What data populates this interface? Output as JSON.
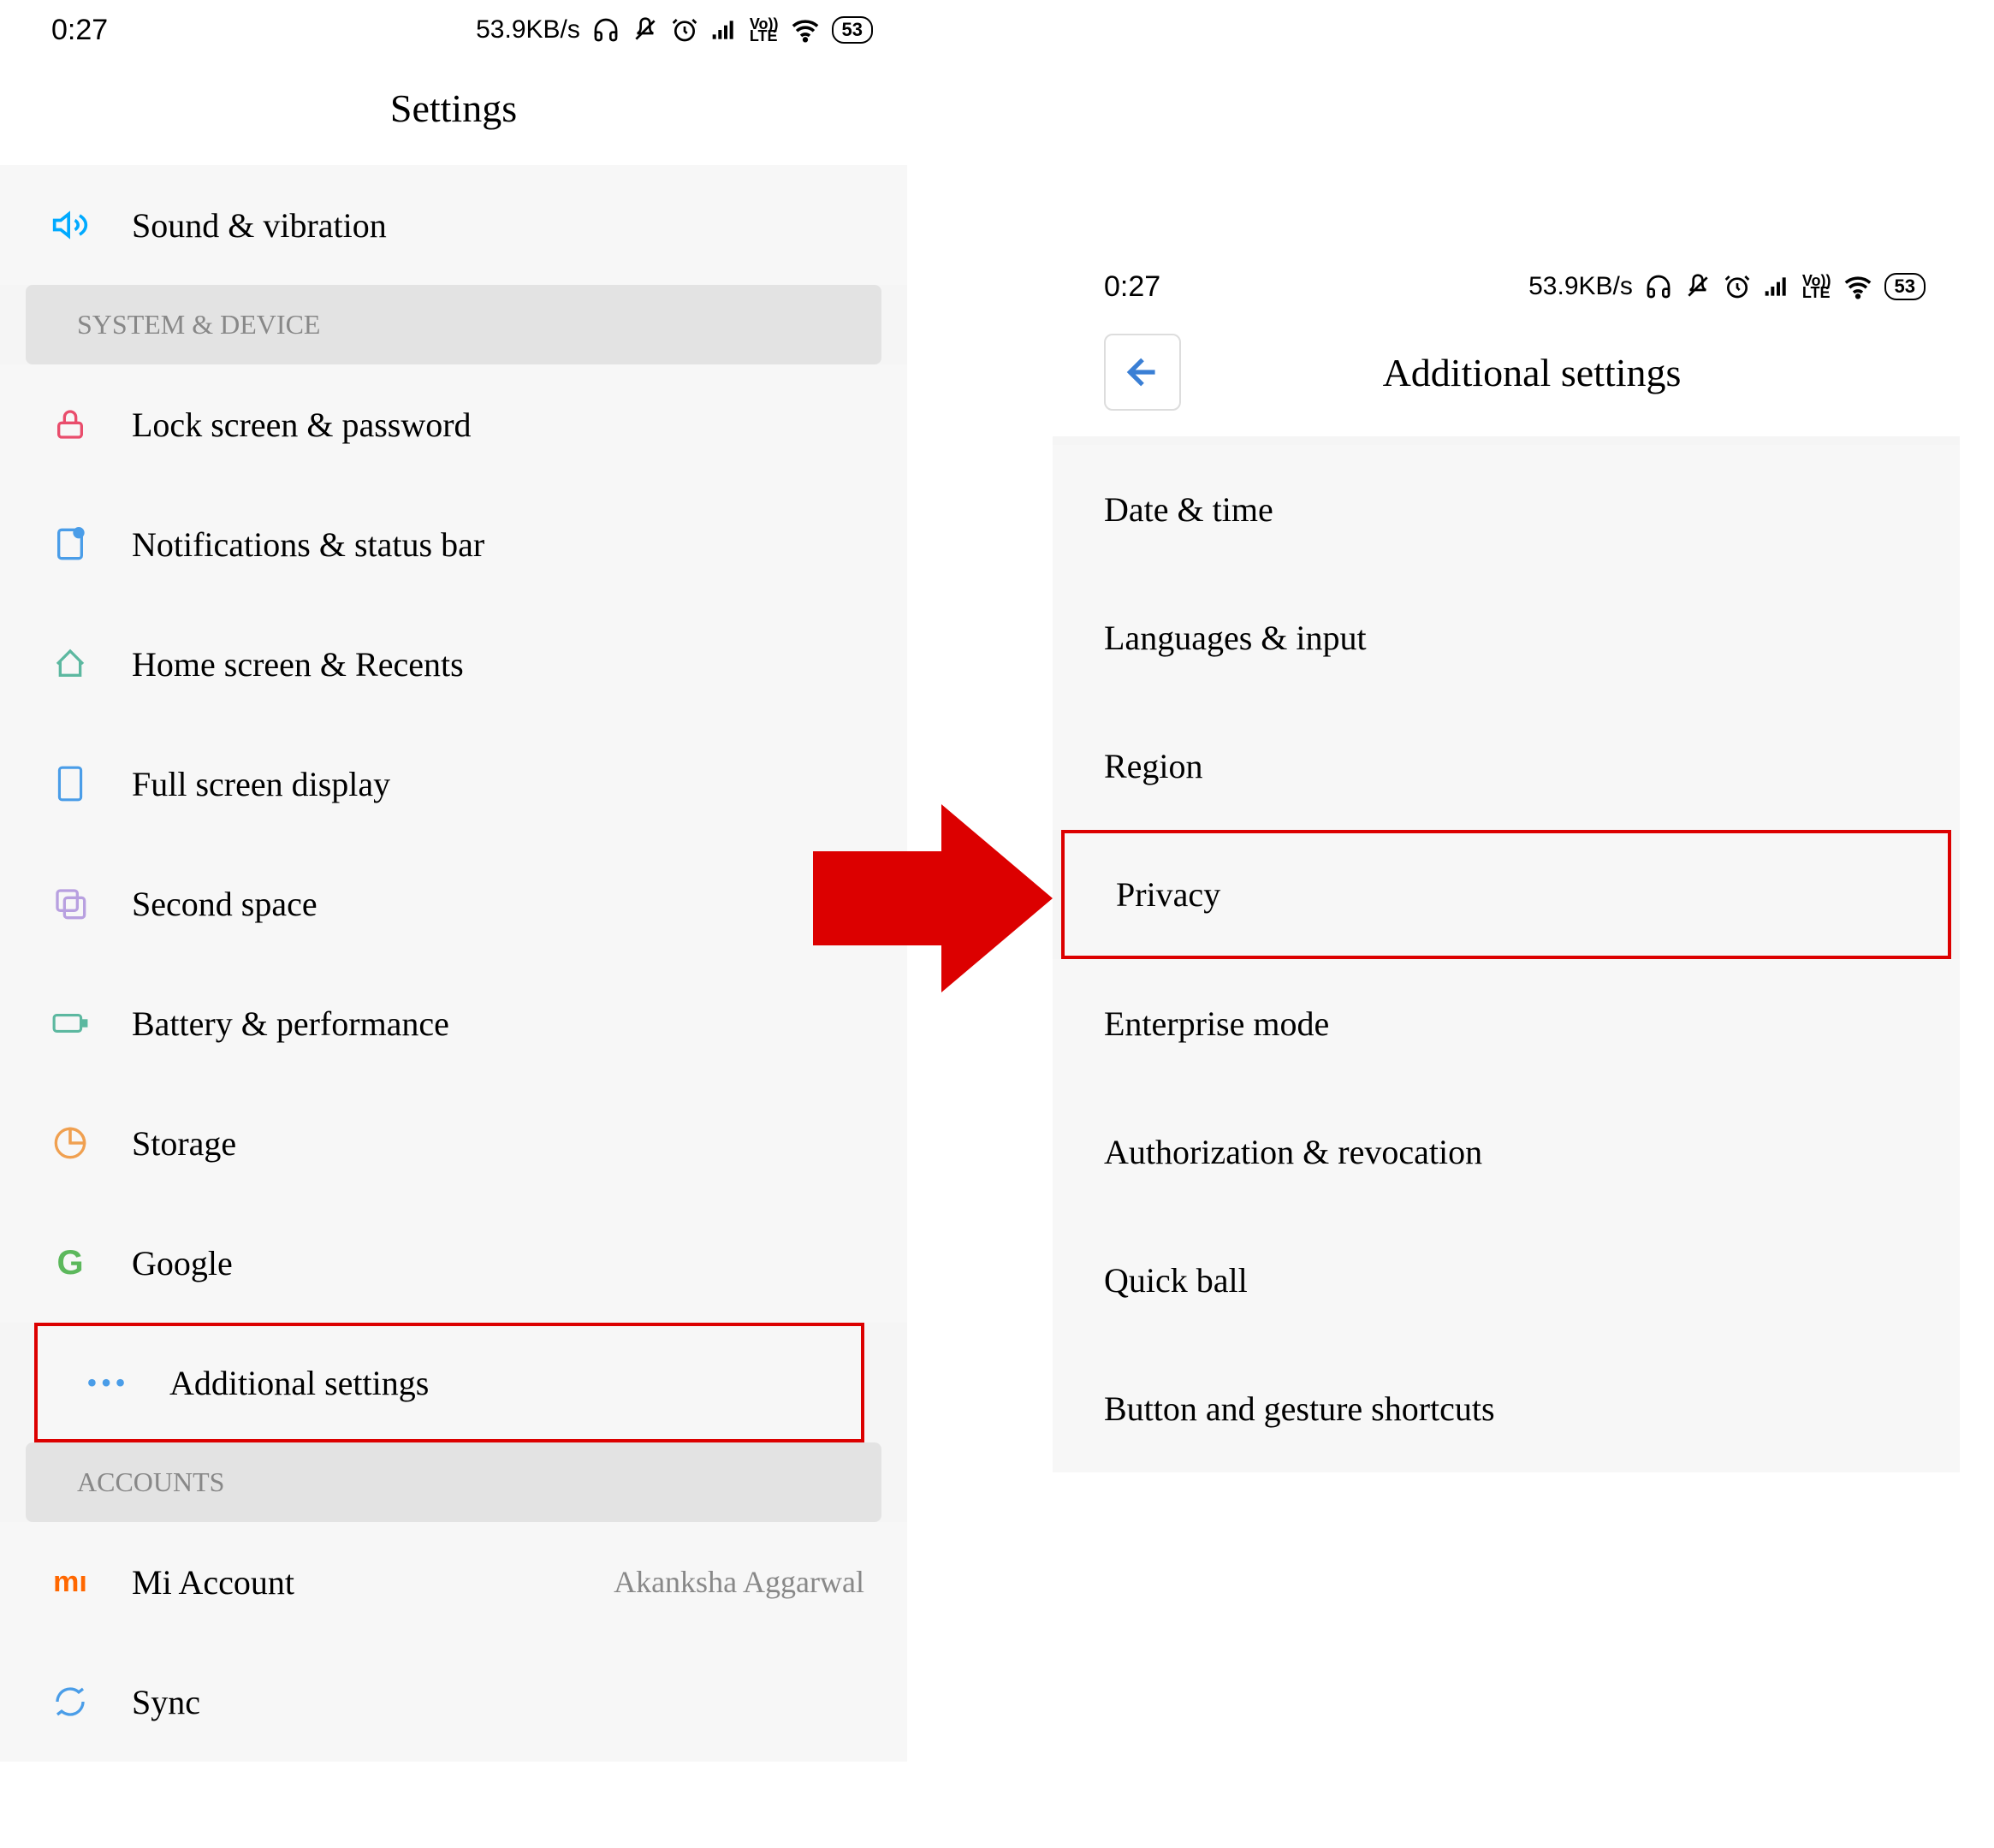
{
  "status_bar": {
    "time": "0:27",
    "speed": "53.9KB/s",
    "battery": "53",
    "volte": "Vo))\nLTE"
  },
  "left_screen": {
    "title": "Settings",
    "top_item": {
      "label": "Sound & vibration",
      "icon": "sound-icon",
      "color": "#00aaff"
    },
    "section1": "SYSTEM & DEVICE",
    "items": [
      {
        "label": "Lock screen & password",
        "color": "#e94d6c"
      },
      {
        "label": "Notifications & status bar",
        "color": "#4a9de8"
      },
      {
        "label": "Home screen & Recents",
        "color": "#5cb8a0"
      },
      {
        "label": "Full screen display",
        "color": "#4a9de8"
      },
      {
        "label": "Second space",
        "color": "#b8a0e0"
      },
      {
        "label": "Battery & performance",
        "color": "#5cb8a0"
      },
      {
        "label": "Storage",
        "color": "#f0a050"
      },
      {
        "label": "Google",
        "color": "#5cb85c"
      },
      {
        "label": "Additional settings",
        "color": "#4a9de8",
        "highlight": true
      }
    ],
    "section2": "ACCOUNTS",
    "accounts": [
      {
        "label": "Mi Account",
        "value": "Akanksha Aggarwal",
        "color": "#ff6700"
      },
      {
        "label": "Sync",
        "color": "#4a9de8"
      }
    ]
  },
  "right_screen": {
    "title": "Additional settings",
    "items": [
      {
        "label": "Date & time"
      },
      {
        "label": "Languages & input"
      },
      {
        "label": "Region"
      },
      {
        "label": "Privacy",
        "highlight": true
      },
      {
        "label": "Enterprise mode"
      },
      {
        "label": "Authorization & revocation"
      },
      {
        "label": "Quick ball"
      },
      {
        "label": "Button and gesture shortcuts"
      }
    ]
  }
}
